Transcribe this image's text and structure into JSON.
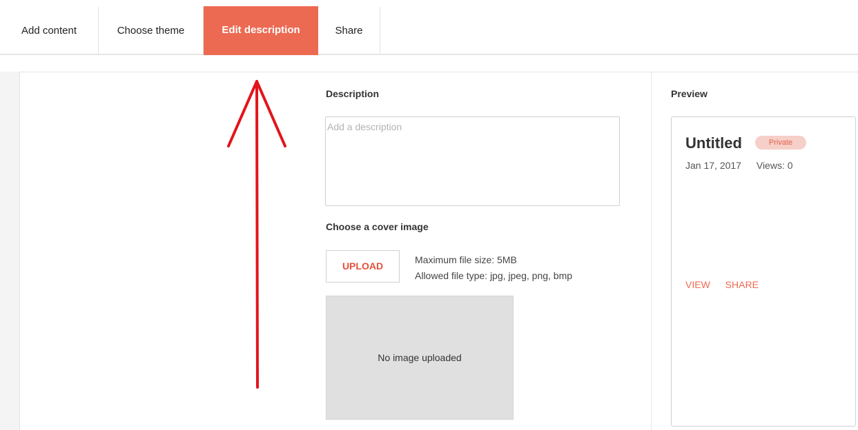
{
  "tabs": [
    {
      "label": "Add content",
      "active": false
    },
    {
      "label": "Choose theme",
      "active": false
    },
    {
      "label": "Edit description",
      "active": true
    },
    {
      "label": "Share",
      "active": false
    }
  ],
  "description": {
    "title": "Description",
    "placeholder": "Add a description",
    "value": ""
  },
  "cover": {
    "title": "Choose a cover image",
    "upload_label": "UPLOAD",
    "max_size": "Maximum file size: 5MB",
    "allowed_types": "Allowed file type: jpg, jpeg, png, bmp",
    "empty_text": "No image uploaded"
  },
  "preview": {
    "title": "Preview",
    "card_title": "Untitled",
    "badge": "Private",
    "date": "Jan 17, 2017",
    "views": "Views: 0",
    "view_link": "VIEW",
    "share_link": "SHARE"
  },
  "colors": {
    "accent": "#ec6a52",
    "annotation": "#e3141b"
  }
}
